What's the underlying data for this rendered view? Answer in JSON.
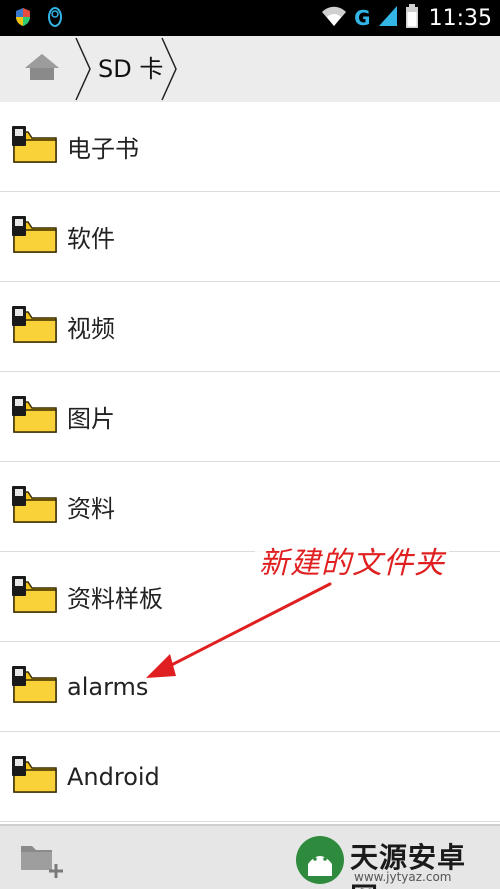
{
  "status_bar": {
    "time": "11:35",
    "network_type": "G",
    "icons": [
      "shield-icon",
      "penguin-icon",
      "wifi-icon",
      "signal-icon",
      "battery-icon"
    ]
  },
  "header": {
    "home_icon": "home-icon",
    "breadcrumb_label": "SD 卡"
  },
  "folders": [
    {
      "label": "电子书"
    },
    {
      "label": "软件"
    },
    {
      "label": "视频"
    },
    {
      "label": "图片"
    },
    {
      "label": "资料"
    },
    {
      "label": "资料样板"
    },
    {
      "label": "alarms"
    },
    {
      "label": "Android"
    }
  ],
  "annotation": {
    "text": "新建的文件夹",
    "color": "#e02020"
  },
  "bottom_bar": {
    "new_folder_icon": "new-folder-icon",
    "watermark_name": "天源安卓网",
    "watermark_url": "www.jytyaz.com"
  },
  "colors": {
    "folder_yellow": "#f5c518",
    "status_accent": "#33b5e5",
    "header_bg": "#ececec"
  }
}
